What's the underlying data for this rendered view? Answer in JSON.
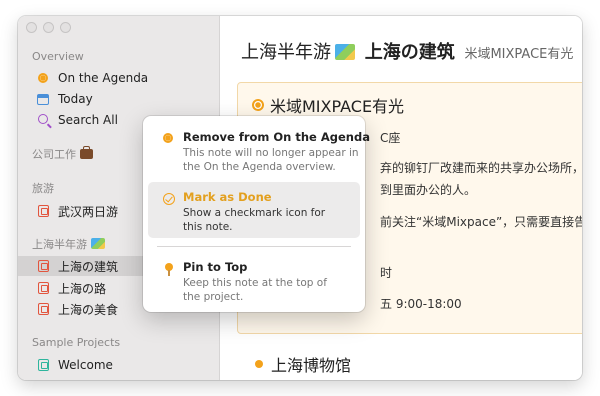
{
  "sidebar": {
    "overview_heading": "Overview",
    "overview_items": [
      {
        "label": "On the Agenda",
        "icon": "agenda-dot-icon"
      },
      {
        "label": "Today",
        "icon": "calendar-icon"
      },
      {
        "label": "Search All",
        "icon": "search-icon"
      }
    ],
    "group1_heading": "公司工作",
    "group2_heading": "旅游",
    "group2_items": [
      {
        "label": "武汉两日游"
      }
    ],
    "group3_heading": "上海半年游",
    "group3_items": [
      {
        "label": "上海の建筑",
        "selected": true
      },
      {
        "label": "上海の路"
      },
      {
        "label": "上海の美食"
      }
    ],
    "group4_heading": "Sample Projects",
    "group4_items": [
      {
        "label": "Welcome"
      }
    ]
  },
  "main": {
    "title_project": "上海半年游",
    "title_note": "上海の建筑",
    "title_sub": "米域MIXPACE有光",
    "card_title": "米域MIXPACE有光",
    "card_lines": [
      "C座",
      "弃的铆钉厂改建而来的共享办公场所，开",
      "到里面办公的人。",
      "前关注“米域Mixpace”，只需要直接告诉",
      "时",
      "五 9:00-18:00"
    ],
    "bottom_item": "上海博物馆"
  },
  "menu": {
    "items": [
      {
        "title": "Remove from On the Agenda",
        "desc": [
          "This note will no longer appear in",
          "the On the Agenda overview."
        ],
        "icon": "agenda-dot-icon"
      },
      {
        "title": "Mark as Done",
        "desc": [
          "Show a checkmark icon for",
          "this note."
        ],
        "icon": "checkmark-icon"
      },
      {
        "title": "Pin to Top",
        "desc": [
          "Keep this note at the top of",
          "the project."
        ],
        "icon": "pin-icon"
      }
    ]
  },
  "colors": {
    "accent": "#f3a21b",
    "sidebar_bg": "#eae8e8",
    "card_bg": "#fff8ec"
  }
}
